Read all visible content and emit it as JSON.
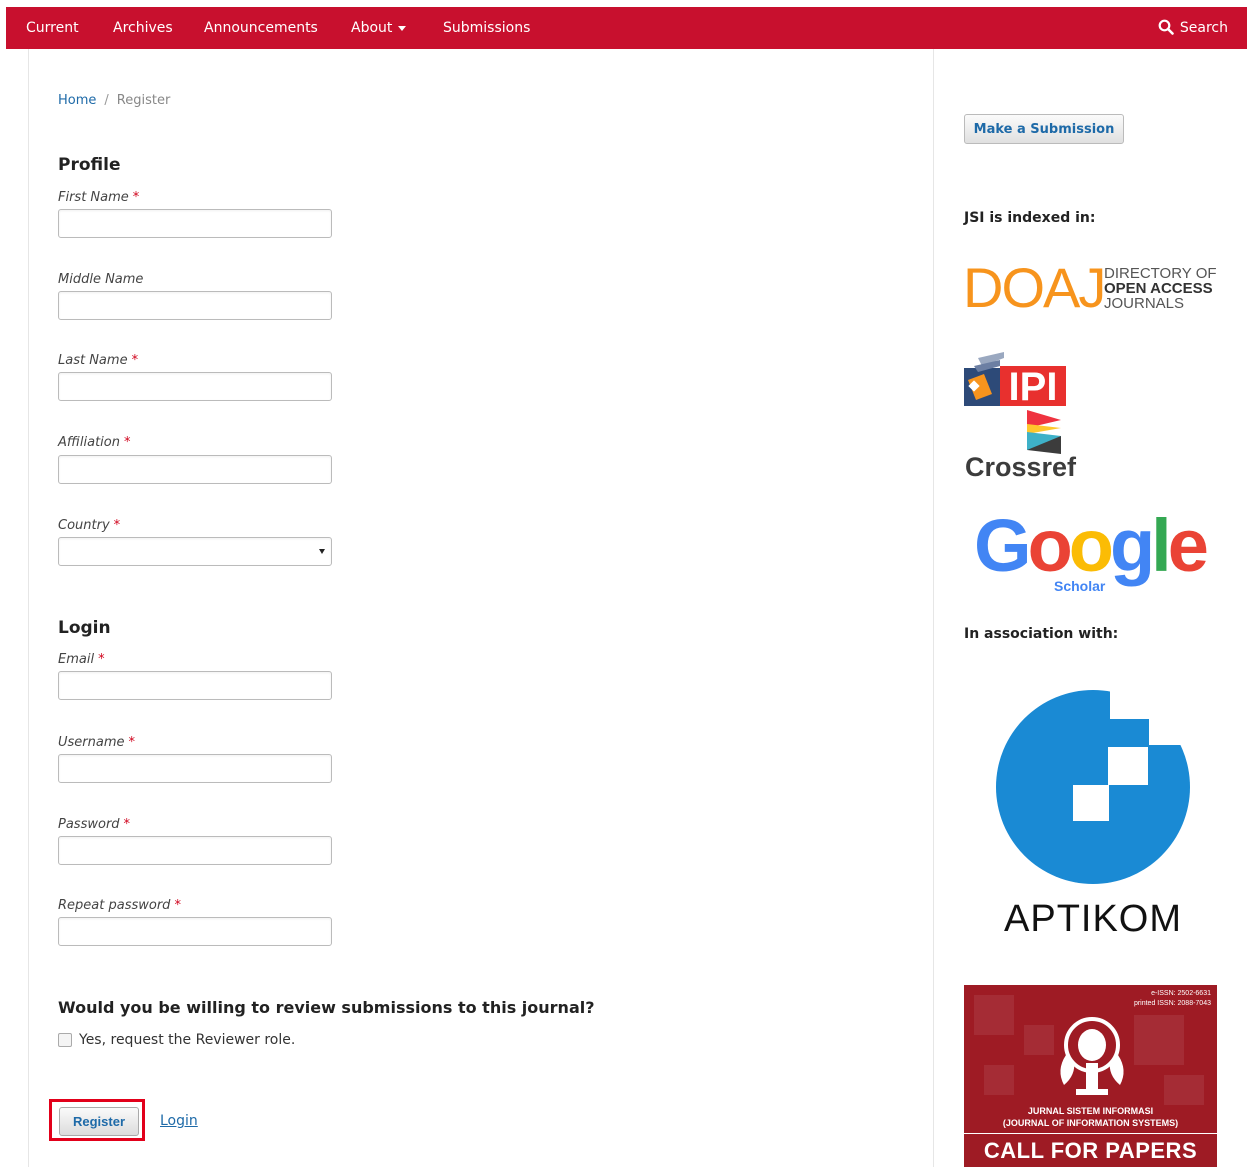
{
  "nav": {
    "items": [
      "Current",
      "Archives",
      "Announcements",
      "About",
      "Submissions"
    ],
    "search_label": "Search"
  },
  "breadcrumb": {
    "home": "Home",
    "separator": "/",
    "current": "Register"
  },
  "profile": {
    "heading": "Profile",
    "first_name": "First Name",
    "middle_name": "Middle Name",
    "last_name": "Last Name",
    "affiliation": "Affiliation",
    "country": "Country",
    "country_value": ""
  },
  "login": {
    "heading": "Login",
    "email": "Email",
    "username": "Username",
    "password": "Password",
    "repeat_password": "Repeat password"
  },
  "required_mark": "*",
  "review": {
    "question": "Would you be willing to review submissions to this journal?",
    "checkbox_label": "Yes, request the Reviewer role.",
    "checked": false
  },
  "actions": {
    "register": "Register",
    "login": "Login"
  },
  "sidebar": {
    "submit_button": "Make a Submission",
    "indexed_heading": "JSI is indexed in:",
    "doaj": {
      "big": "DOAJ",
      "line1": "DIRECTORY OF",
      "line2": "OPEN ACCESS",
      "line3": "JOURNALS"
    },
    "ipi": "IPI",
    "crossref": "Crossref",
    "google": {
      "word": "Google",
      "sub": "Scholar"
    },
    "association_heading": "In association with:",
    "aptikom": "APTIKOM",
    "poster": {
      "issn_line1": "e-ISSN: 2502-6631",
      "issn_line2": "printed ISSN: 2088-7043",
      "title_line1": "JURNAL SISTEM INFORMASI",
      "title_line2": "(JOURNAL OF INFORMATION SYSTEMS)",
      "cfp": "CALL FOR PAPERS"
    }
  },
  "colors": {
    "nav_bg": "#c8102e",
    "link": "#1e6aa8",
    "required": "#d0021b",
    "highlight": "#e2001a",
    "doaj": "#f7941d",
    "aptikom": "#1a8ad4"
  }
}
